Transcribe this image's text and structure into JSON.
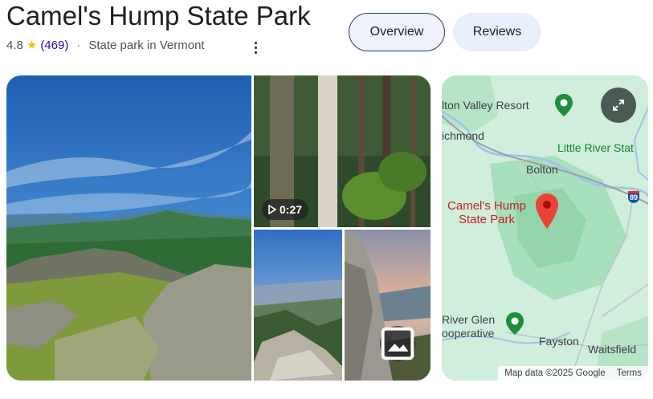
{
  "place": {
    "name": "Camel's Hump State Park",
    "rating": "4.8",
    "review_count": "(469)",
    "separator": "·",
    "category": "State park in Vermont"
  },
  "tabs": [
    {
      "label": "Overview",
      "selected": true
    },
    {
      "label": "Reviews",
      "selected": false
    }
  ],
  "gallery": {
    "video_duration": "0:27"
  },
  "map": {
    "labels": {
      "valley_resort": "lton Valley Resort",
      "richmond": "ichmond",
      "little_river": "Little River Stat",
      "bolton": "Bolton",
      "park_line1": "Camel's Hump",
      "park_line2": "State Park",
      "interstate": "89",
      "river_glen_line1": "River Glen",
      "river_glen_line2": "ooperative",
      "fayston": "Fayston",
      "waitsfield": "Waitsfield"
    },
    "attribution": "Map data ©2025 Google",
    "terms": "Terms"
  },
  "icons": {
    "rating_star": "star-icon",
    "more": "more-vert-icon",
    "play": "play-icon",
    "image": "image-icon",
    "expand": "expand-icon",
    "pin": "map-pin-icon"
  },
  "colors": {
    "star": "#fbbc04",
    "review_link": "#1a0dab",
    "pin_red": "#ea4335",
    "poi_green": "#1e8e3e"
  }
}
